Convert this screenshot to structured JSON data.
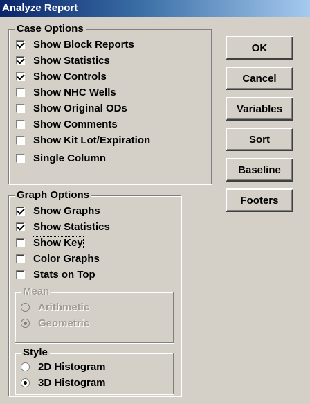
{
  "window": {
    "title": "Analyze Report"
  },
  "case_options": {
    "title": "Case Options",
    "items": [
      {
        "label": "Show Block Reports",
        "checked": true
      },
      {
        "label": "Show Statistics",
        "checked": true
      },
      {
        "label": "Show Controls",
        "checked": true
      },
      {
        "label": "Show NHC Wells",
        "checked": false
      },
      {
        "label": "Show Original ODs",
        "checked": false
      },
      {
        "label": "Show Comments",
        "checked": false
      },
      {
        "label": "Show Kit Lot/Expiration",
        "checked": false
      },
      {
        "label": "Single Column",
        "checked": false
      }
    ]
  },
  "graph_options": {
    "title": "Graph Options",
    "items": [
      {
        "label": "Show Graphs",
        "checked": true
      },
      {
        "label": "Show Statistics",
        "checked": true
      },
      {
        "label": "Show Key",
        "checked": false
      },
      {
        "label": "Color Graphs",
        "checked": false
      },
      {
        "label": "Stats on Top",
        "checked": false
      }
    ],
    "mean": {
      "title": "Mean",
      "enabled": false,
      "options": [
        {
          "label": "Arithmetic",
          "selected": false
        },
        {
          "label": "Geometric",
          "selected": true
        }
      ]
    },
    "style": {
      "title": "Style",
      "options": [
        {
          "label": "2D Histogram",
          "selected": false
        },
        {
          "label": "3D Histogram",
          "selected": true
        }
      ]
    }
  },
  "buttons": {
    "ok": "OK",
    "cancel": "Cancel",
    "variables": "Variables",
    "sort": "Sort",
    "baseline": "Baseline",
    "footers": "Footers"
  }
}
